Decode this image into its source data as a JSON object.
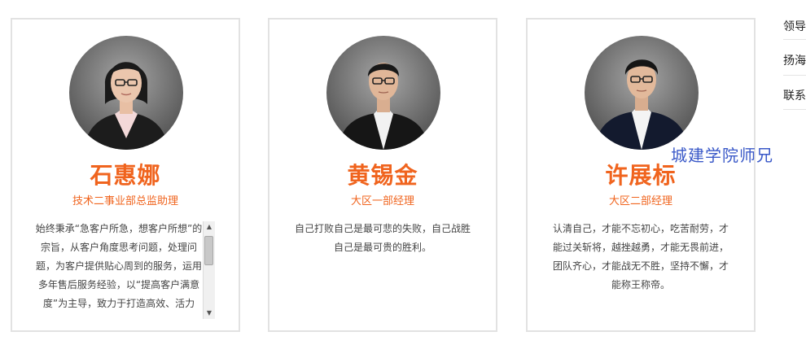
{
  "cards": [
    {
      "name": "石惠娜",
      "title": "技术二事业部总监助理",
      "description": "始终秉承“急客户所急，想客户所想”的宗旨，从客户角度思考问题，处理问题，为客户提供贴心周到的服务，运用多年售后服务经验，以“提高客户满意度”为主导，致力于打造高效、活力"
    },
    {
      "name": "黄锡金",
      "title": "大区一部经理",
      "description": "自己打败自己是最可悲的失败，自己战胜自己是最可贵的胜利。"
    },
    {
      "name": "许展标",
      "title": "大区二部经理",
      "description": "认清自己，才能不忘初心，吃苦耐劳，才能过关斩将，越挫越勇，才能无畏前进，团队齐心，才能战无不胜，坚持不懈，才能称王称帝。"
    }
  ],
  "sidebar": {
    "items": [
      "领导",
      "扬海",
      "联系"
    ]
  },
  "watermark": "城建学院师兄",
  "colors": {
    "accent": "#f0641e",
    "card_border": "#e2e2e2",
    "watermark": "#3a59c8"
  }
}
